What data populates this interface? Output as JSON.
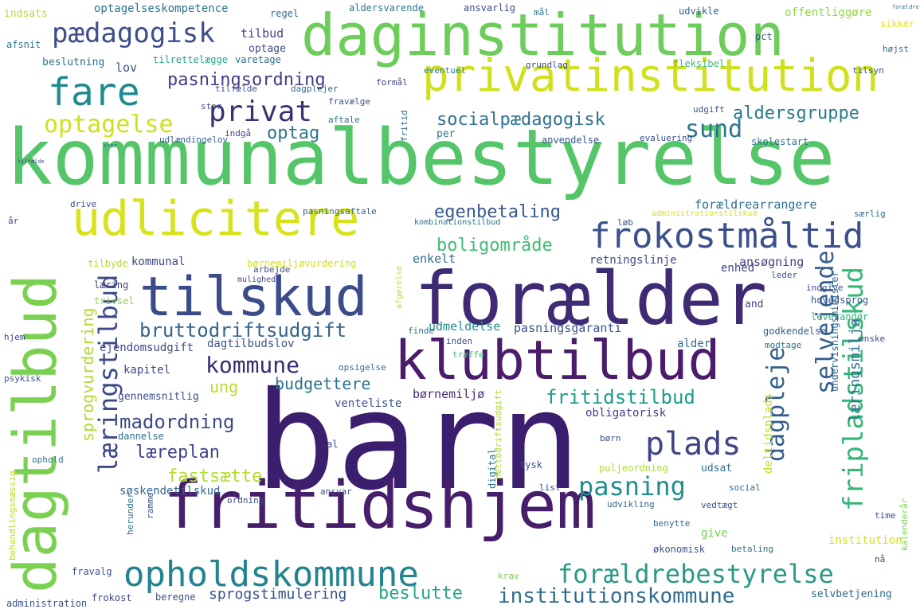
{
  "words": [
    {
      "text": "barn",
      "color": "#3b1f6e"
    },
    {
      "text": "kommunalbestyrelse",
      "color": "#54c568"
    },
    {
      "text": "forælder",
      "color": "#3e2b74"
    },
    {
      "text": "fritidshjem",
      "color": "#461e6a"
    },
    {
      "text": "daginstitution",
      "color": "#6ccd5a"
    },
    {
      "text": "dagtilbud",
      "color": "#7ad151"
    },
    {
      "text": "tilskud",
      "color": "#3c4b8a"
    },
    {
      "text": "klubtilbud",
      "color": "#4a1c6b"
    },
    {
      "text": "udlicitere",
      "color": "#d8e219"
    },
    {
      "text": "privatinstitution",
      "color": "#d0e11c"
    },
    {
      "text": "frokostmåltid",
      "color": "#3c508b"
    },
    {
      "text": "opholdskommune",
      "color": "#22848e"
    },
    {
      "text": "fare",
      "color": "#1f8b8d"
    },
    {
      "text": "pædagogisk",
      "color": "#3d4e8a"
    },
    {
      "text": "optagelse",
      "color": "#cde11d"
    },
    {
      "text": "privat",
      "color": "#3e2f6f"
    },
    {
      "text": "forældrebestyrelse",
      "color": "#2a9a85"
    },
    {
      "text": "institutionskommune",
      "color": "#2f6d8e"
    },
    {
      "text": "læringstilbud",
      "color": "#3d4a89"
    },
    {
      "text": "pasning",
      "color": "#218e8d"
    },
    {
      "text": "plads",
      "color": "#404588"
    },
    {
      "text": "kommune",
      "color": "#3a2a72"
    },
    {
      "text": "selvejende",
      "color": "#365d8d"
    },
    {
      "text": "fripladstilskud",
      "color": "#35b779"
    },
    {
      "text": "dagpleje",
      "color": "#355f8d"
    },
    {
      "text": "sund",
      "color": "#2b758e"
    },
    {
      "text": "socialpædagogisk",
      "color": "#2e6f8e"
    },
    {
      "text": "bruttodriftsudgift",
      "color": "#33638d"
    },
    {
      "text": "pasningsordning",
      "color": "#433e85"
    },
    {
      "text": "egenbetaling",
      "color": "#38598c"
    },
    {
      "text": "boligområde",
      "color": "#3fbc73"
    },
    {
      "text": "madordning",
      "color": "#3d4b89"
    },
    {
      "text": "læreplan",
      "color": "#404688"
    },
    {
      "text": "fastsætte",
      "color": "#b0dd2f"
    },
    {
      "text": "budgettere",
      "color": "#2c728e"
    },
    {
      "text": "beslutte",
      "color": "#23a983"
    },
    {
      "text": "fritidstilbud",
      "color": "#1e9b8a"
    },
    {
      "text": "optag",
      "color": "#2a778e"
    },
    {
      "text": "aldersgruppe",
      "color": "#297b8e"
    },
    {
      "text": "sprogvurdering",
      "color": "#addc30"
    },
    {
      "text": "sprogstimulering",
      "color": "#3b518b"
    },
    {
      "text": "læringsmiljø",
      "color": "#2c718e"
    },
    {
      "text": "ung",
      "color": "#bade28"
    },
    {
      "text": "dagtilbudslov",
      "color": "#3a538b"
    },
    {
      "text": "kapitel",
      "color": "#3f4788"
    },
    {
      "text": "børnemiljø",
      "color": "#472c7a"
    },
    {
      "text": "venteliste",
      "color": "#3b528b"
    },
    {
      "text": "obligatorisk",
      "color": "#424086"
    },
    {
      "text": "udmeldelse",
      "color": "#238a8d"
    },
    {
      "text": "pasningsgaranti",
      "color": "#3b528b"
    },
    {
      "text": "forældrearrangere",
      "color": "#2c718e"
    },
    {
      "text": "retningslinje",
      "color": "#3e4989"
    },
    {
      "text": "ansøgning",
      "color": "#424186"
    },
    {
      "text": "enkelt",
      "color": "#2e6e8e"
    },
    {
      "text": "kommunal",
      "color": "#3e4a89"
    },
    {
      "text": "børnemiljøvurdering",
      "color": "#d5e21a"
    },
    {
      "text": "tilbyde",
      "color": "#b2dd2d"
    },
    {
      "text": "søskendetilskud",
      "color": "#31688e"
    },
    {
      "text": "ejendomsudgift",
      "color": "#3f4889"
    },
    {
      "text": "gennemsnitlig",
      "color": "#3c4f8a"
    },
    {
      "text": "dannelse",
      "color": "#2e6e8e"
    },
    {
      "text": "alder",
      "color": "#2f6c8e"
    },
    {
      "text": "deltidsplads",
      "color": "#c0df25"
    },
    {
      "text": "enhed",
      "color": "#3f4788"
    },
    {
      "text": "tilbud",
      "color": "#404387"
    },
    {
      "text": "optage",
      "color": "#3e4c8a"
    },
    {
      "text": "lov",
      "color": "#3b528b"
    },
    {
      "text": "tilrettelægge",
      "color": "#22a884"
    },
    {
      "text": "varetage",
      "color": "#2e6d8e"
    },
    {
      "text": "optagelseskompetence",
      "color": "#2c728e"
    },
    {
      "text": "indsats",
      "color": "#b5de2b"
    },
    {
      "text": "afsnit",
      "color": "#2b748e"
    },
    {
      "text": "beslutning",
      "color": "#2c718e"
    },
    {
      "text": "regel",
      "color": "#2f6b8e"
    },
    {
      "text": "aldersvarende",
      "color": "#2a768e"
    },
    {
      "text": "ansvarlig",
      "color": "#3e4a89"
    },
    {
      "text": "mål",
      "color": "#2d718e"
    },
    {
      "text": "udvikle",
      "color": "#35608d"
    },
    {
      "text": "offentliggøre",
      "color": "#8fd744"
    },
    {
      "text": "sikker",
      "color": "#e7e419"
    },
    {
      "text": "højst",
      "color": "#2f6c8e"
    },
    {
      "text": "pct",
      "color": "#3a548c"
    },
    {
      "text": "fleksibel",
      "color": "#38b977"
    },
    {
      "text": "tilsyn",
      "color": "#3b518b"
    },
    {
      "text": "grundlag",
      "color": "#3e4989"
    },
    {
      "text": "eventuel",
      "color": "#2a788e"
    },
    {
      "text": "formål",
      "color": "#404387"
    },
    {
      "text": "tilfælde",
      "color": "#3b528b"
    },
    {
      "text": "dagplejer",
      "color": "#2f6b8e"
    },
    {
      "text": "fravælge",
      "color": "#3d4d8a"
    },
    {
      "text": "aftale",
      "color": "#2d708e"
    },
    {
      "text": "udgift",
      "color": "#3b528b"
    },
    {
      "text": "stor",
      "color": "#3e4b8a"
    },
    {
      "text": "fritid",
      "color": "#2c718e"
    },
    {
      "text": "per",
      "color": "#2b758e"
    },
    {
      "text": "anvendelse",
      "color": "#3a548c"
    },
    {
      "text": "evaluering",
      "color": "#3b518b"
    },
    {
      "text": "skolestart",
      "color": "#2e6f8e"
    },
    {
      "text": "indgå",
      "color": "#3f4788"
    },
    {
      "text": "udlændingelov",
      "color": "#35608d"
    },
    {
      "text": "drive",
      "color": "#3c4f8a"
    },
    {
      "text": "pasningsaftale",
      "color": "#33638d"
    },
    {
      "text": "år",
      "color": "#3d4d8a"
    },
    {
      "text": "kombinationstilbud",
      "color": "#2c728e"
    },
    {
      "text": "løb",
      "color": "#3b528b"
    },
    {
      "text": "administrationstilskud",
      "color": "#d6e21a"
    },
    {
      "text": "særlig",
      "color": "#2e6e8e"
    },
    {
      "text": "læring",
      "color": "#414487"
    },
    {
      "text": "mulighed",
      "color": "#3f4788"
    },
    {
      "text": "arbejde",
      "color": "#3d4d8a"
    },
    {
      "text": "trivsel",
      "color": "#8bd646"
    },
    {
      "text": "leder",
      "color": "#3a538b"
    },
    {
      "text": "and",
      "color": "#404387"
    },
    {
      "text": "indgive",
      "color": "#3b528b"
    },
    {
      "text": "hovedsprog",
      "color": "#3b528b"
    },
    {
      "text": "undervisningsminister",
      "color": "#2f6b8e"
    },
    {
      "text": "leverandør",
      "color": "#35b779"
    },
    {
      "text": "godkendelse",
      "color": "#365c8d"
    },
    {
      "text": "ønske",
      "color": "#3e4c8a"
    },
    {
      "text": "modtage",
      "color": "#2a788e"
    },
    {
      "text": "inden",
      "color": "#3b528b"
    },
    {
      "text": "finde",
      "color": "#2e6f8e"
    },
    {
      "text": "afgørelse",
      "color": "#b8de29"
    },
    {
      "text": "træffe",
      "color": "#3fbc73"
    },
    {
      "text": "opsigelse",
      "color": "#2c728e"
    },
    {
      "text": "hjem",
      "color": "#3e4a89"
    },
    {
      "text": "psykisk",
      "color": "#3b528b"
    },
    {
      "text": "digital",
      "color": "#2c718e"
    },
    {
      "text": "nettodriftsudgift",
      "color": "#a8db34"
    },
    {
      "text": "børn",
      "color": "#3a548c"
    },
    {
      "text": "puljeordning",
      "color": "#addc30"
    },
    {
      "text": "tysk",
      "color": "#3d4e8a"
    },
    {
      "text": "udsat",
      "color": "#2e6e8e"
    },
    {
      "text": "social",
      "color": "#2f6b8e"
    },
    {
      "text": "list",
      "color": "#404387"
    },
    {
      "text": "al",
      "color": "#3e4c8a"
    },
    {
      "text": "ophold",
      "color": "#2c718e"
    },
    {
      "text": "ansvar",
      "color": "#3b528b"
    },
    {
      "text": "ordning",
      "color": "#3d4d8a"
    },
    {
      "text": "herunder",
      "color": "#2f6c8e"
    },
    {
      "text": "ramme",
      "color": "#3a538b"
    },
    {
      "text": "behandlingsmæssig",
      "color": "#b5de2b"
    },
    {
      "text": "vedtægt",
      "color": "#3b528b"
    },
    {
      "text": "benytte",
      "color": "#2e6e8e"
    },
    {
      "text": "udvikling",
      "color": "#35608d"
    },
    {
      "text": "give",
      "color": "#73d056"
    },
    {
      "text": "time",
      "color": "#3e4a89"
    },
    {
      "text": "institution",
      "color": "#d0e11c"
    },
    {
      "text": "økonomisk",
      "color": "#3b528b"
    },
    {
      "text": "betaling",
      "color": "#2c728e"
    },
    {
      "text": "kalenderår",
      "color": "#7ad151"
    },
    {
      "text": "nå",
      "color": "#414487"
    },
    {
      "text": "fravalg",
      "color": "#3b518b"
    },
    {
      "text": "frokost",
      "color": "#3e4989"
    },
    {
      "text": "beregne",
      "color": "#3d4d8a"
    },
    {
      "text": "krav",
      "color": "#7ad151"
    },
    {
      "text": "administration",
      "color": "#3b528b"
    },
    {
      "text": "selvbetjening",
      "color": "#2f6b8e"
    },
    {
      "text": "forældre",
      "color": "#2c728e"
    },
    {
      "text": "tilfælde",
      "color": "#3e4c8a"
    },
    {
      "text": "stor",
      "color": "#2e6f8e"
    }
  ]
}
